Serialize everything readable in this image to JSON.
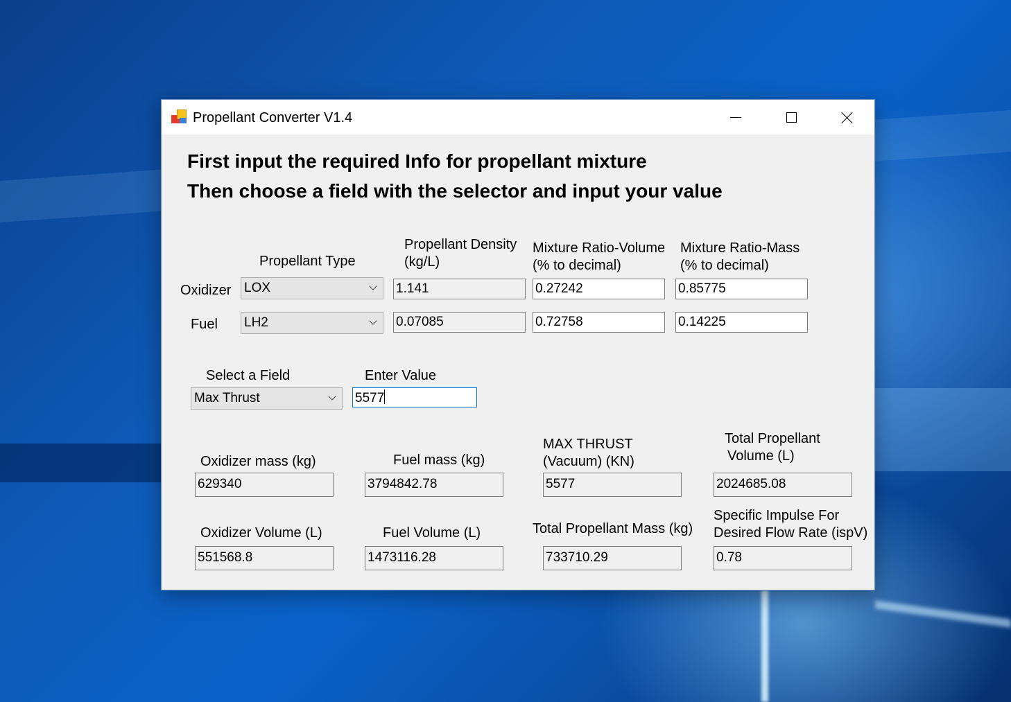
{
  "window": {
    "title": "Propellant Converter V1.4",
    "icon": "app-colored-squares-icon",
    "controls": {
      "minimize": "minimize-icon",
      "maximize": "maximize-icon",
      "close": "close-icon"
    }
  },
  "instructions": {
    "line1": "First input the required Info for propellant mixture",
    "line2": "Then choose a field with the selector and input your value"
  },
  "mixture": {
    "headers": {
      "propellant_type": "Propellant Type",
      "density_line1": "Propellant Density",
      "density_line2": "(kg/L)",
      "ratio_volume_line1": "Mixture Ratio-Volume",
      "ratio_volume_line2": "(% to decimal)",
      "ratio_mass_line1": "Mixture Ratio-Mass",
      "ratio_mass_line2": "(% to decimal)"
    },
    "oxidizer": {
      "label": "Oxidizer",
      "type": "LOX",
      "density": "1.141",
      "ratio_volume": "0.27242",
      "ratio_mass": "0.85775"
    },
    "fuel": {
      "label": "Fuel",
      "type": "LH2",
      "density": "0.07085",
      "ratio_volume": "0.72758",
      "ratio_mass": "0.14225"
    }
  },
  "selector": {
    "field_label": "Select a Field",
    "field_value": "Max Thrust",
    "value_label": "Enter Value",
    "value": "5577"
  },
  "results": {
    "oxidizer_mass_label": "Oxidizer mass (kg)",
    "oxidizer_mass": "629340",
    "fuel_mass_label": "Fuel mass (kg)",
    "fuel_mass": "3794842.78",
    "max_thrust_label_line1": "MAX THRUST",
    "max_thrust_label_line2": "(Vacuum) (KN)",
    "max_thrust": "5577",
    "total_volume_label_line1": "Total Propellant",
    "total_volume_label_line2": "Volume (L)",
    "total_volume": "2024685.08",
    "oxidizer_volume_label": "Oxidizer Volume (L)",
    "oxidizer_volume": "551568.8",
    "fuel_volume_label": "Fuel Volume (L)",
    "fuel_volume": "1473116.28",
    "total_mass_label": "Total Propellant Mass (kg)",
    "total_mass": "733710.29",
    "isp_label_line1": "Specific Impulse  For",
    "isp_label_line2": "Desired Flow Rate (ispV)",
    "isp": "0.78"
  }
}
